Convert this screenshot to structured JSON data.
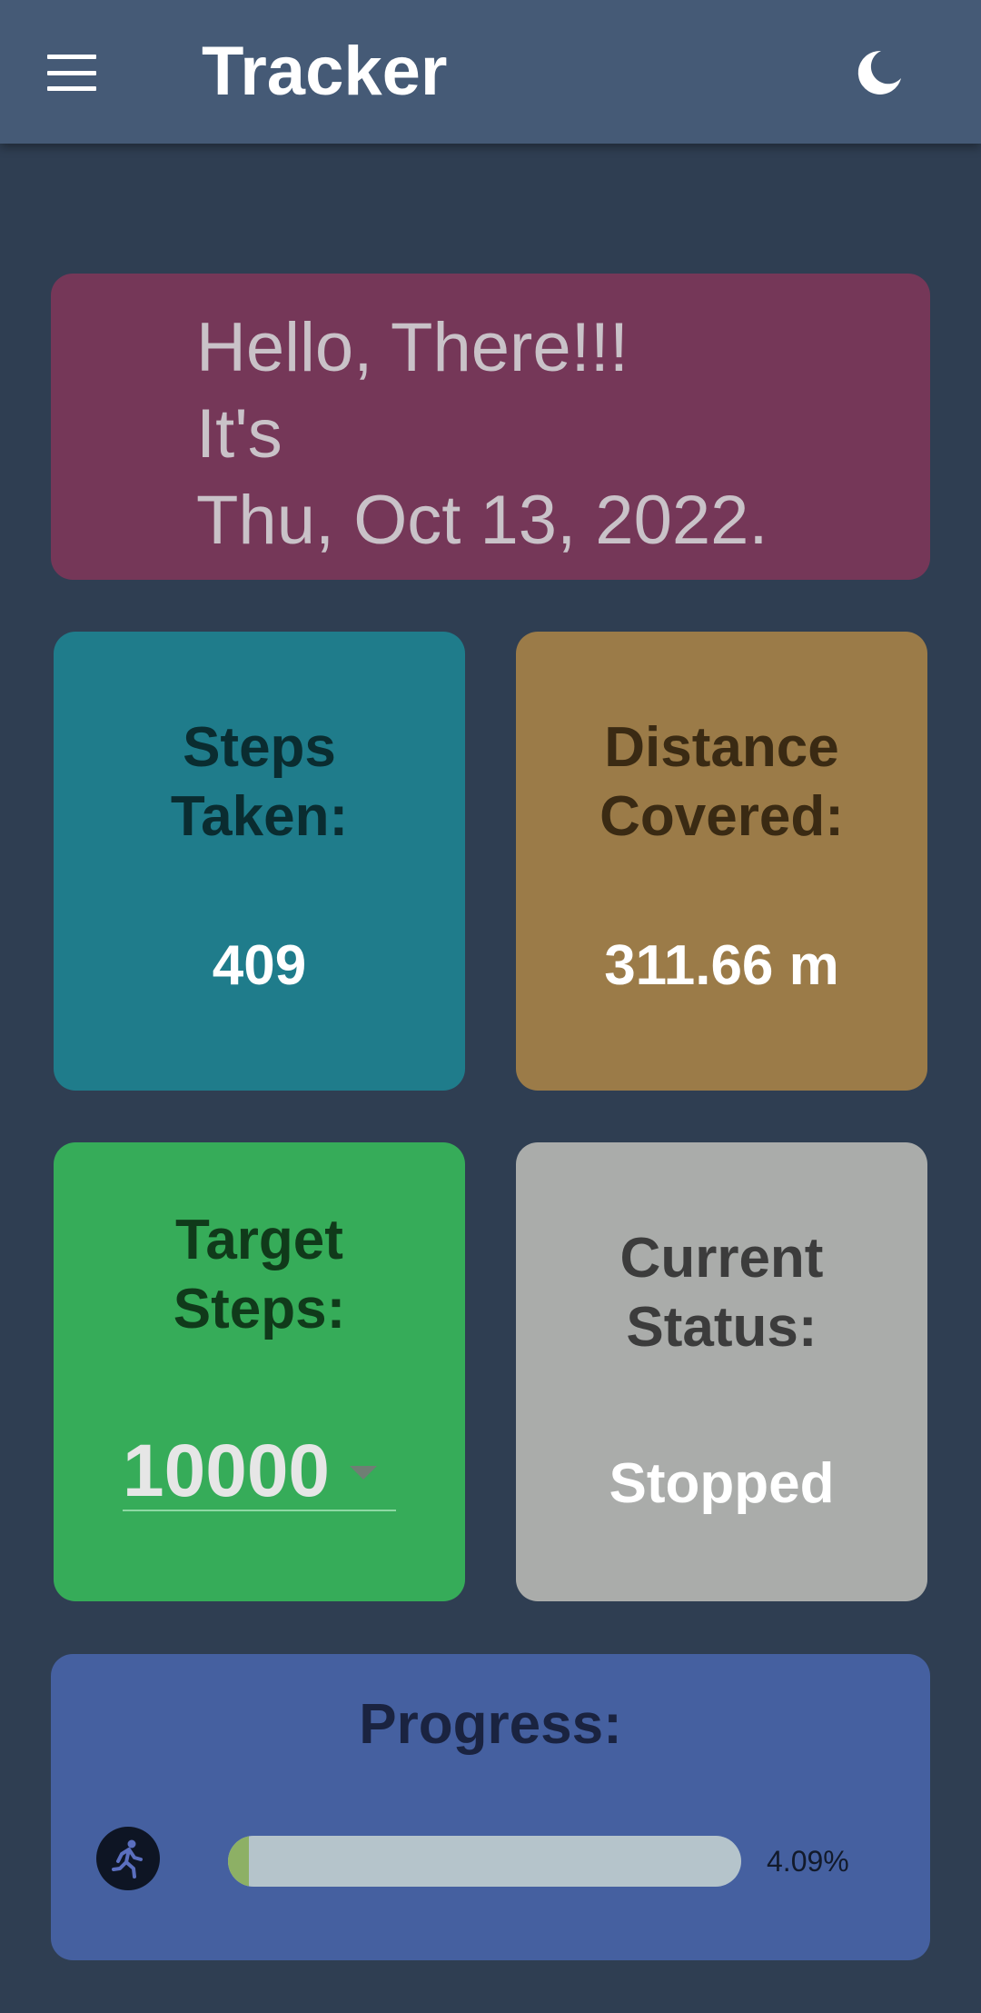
{
  "appbar": {
    "title": "Tracker",
    "menu_icon": "hamburger-menu-icon",
    "theme_icon": "moon-icon"
  },
  "greeting": {
    "line1": "Hello, There!!!",
    "line2": "It's",
    "line3": "Thu, Oct 13, 2022."
  },
  "steps_card": {
    "title_line1": "Steps",
    "title_line2": "Taken:",
    "value": "409"
  },
  "distance_card": {
    "title_line1": "Distance",
    "title_line2": "Covered:",
    "value": "311.66 m"
  },
  "target_card": {
    "title_line1": "Target",
    "title_line2": "Steps:",
    "selected": "10000"
  },
  "status_card": {
    "title_line1": "Current",
    "title_line2": "Status:",
    "value": "Stopped"
  },
  "progress": {
    "title": "Progress:",
    "icon": "running-person-icon",
    "percent_label": "4.09%",
    "fraction": 0.0409
  },
  "colors": {
    "background": "#2f3e52",
    "appbar": "#455a76",
    "greeting_card": "#753758",
    "steps_card": "#1f7c8b",
    "distance_card": "#9b7b48",
    "target_card": "#36ac59",
    "status_card": "#aaacaa",
    "progress_card": "#4560a0",
    "progress_fill": "#8db065",
    "progress_track": "#b5c4cb"
  }
}
